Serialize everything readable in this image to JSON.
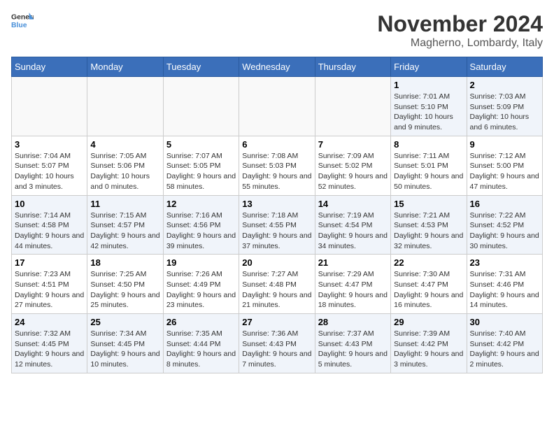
{
  "logo": {
    "text_general": "General",
    "text_blue": "Blue"
  },
  "title": "November 2024",
  "location": "Magherno, Lombardy, Italy",
  "days_of_week": [
    "Sunday",
    "Monday",
    "Tuesday",
    "Wednesday",
    "Thursday",
    "Friday",
    "Saturday"
  ],
  "weeks": [
    [
      {
        "day": "",
        "info": ""
      },
      {
        "day": "",
        "info": ""
      },
      {
        "day": "",
        "info": ""
      },
      {
        "day": "",
        "info": ""
      },
      {
        "day": "",
        "info": ""
      },
      {
        "day": "1",
        "info": "Sunrise: 7:01 AM\nSunset: 5:10 PM\nDaylight: 10 hours and 9 minutes."
      },
      {
        "day": "2",
        "info": "Sunrise: 7:03 AM\nSunset: 5:09 PM\nDaylight: 10 hours and 6 minutes."
      }
    ],
    [
      {
        "day": "3",
        "info": "Sunrise: 7:04 AM\nSunset: 5:07 PM\nDaylight: 10 hours and 3 minutes."
      },
      {
        "day": "4",
        "info": "Sunrise: 7:05 AM\nSunset: 5:06 PM\nDaylight: 10 hours and 0 minutes."
      },
      {
        "day": "5",
        "info": "Sunrise: 7:07 AM\nSunset: 5:05 PM\nDaylight: 9 hours and 58 minutes."
      },
      {
        "day": "6",
        "info": "Sunrise: 7:08 AM\nSunset: 5:03 PM\nDaylight: 9 hours and 55 minutes."
      },
      {
        "day": "7",
        "info": "Sunrise: 7:09 AM\nSunset: 5:02 PM\nDaylight: 9 hours and 52 minutes."
      },
      {
        "day": "8",
        "info": "Sunrise: 7:11 AM\nSunset: 5:01 PM\nDaylight: 9 hours and 50 minutes."
      },
      {
        "day": "9",
        "info": "Sunrise: 7:12 AM\nSunset: 5:00 PM\nDaylight: 9 hours and 47 minutes."
      }
    ],
    [
      {
        "day": "10",
        "info": "Sunrise: 7:14 AM\nSunset: 4:58 PM\nDaylight: 9 hours and 44 minutes."
      },
      {
        "day": "11",
        "info": "Sunrise: 7:15 AM\nSunset: 4:57 PM\nDaylight: 9 hours and 42 minutes."
      },
      {
        "day": "12",
        "info": "Sunrise: 7:16 AM\nSunset: 4:56 PM\nDaylight: 9 hours and 39 minutes."
      },
      {
        "day": "13",
        "info": "Sunrise: 7:18 AM\nSunset: 4:55 PM\nDaylight: 9 hours and 37 minutes."
      },
      {
        "day": "14",
        "info": "Sunrise: 7:19 AM\nSunset: 4:54 PM\nDaylight: 9 hours and 34 minutes."
      },
      {
        "day": "15",
        "info": "Sunrise: 7:21 AM\nSunset: 4:53 PM\nDaylight: 9 hours and 32 minutes."
      },
      {
        "day": "16",
        "info": "Sunrise: 7:22 AM\nSunset: 4:52 PM\nDaylight: 9 hours and 30 minutes."
      }
    ],
    [
      {
        "day": "17",
        "info": "Sunrise: 7:23 AM\nSunset: 4:51 PM\nDaylight: 9 hours and 27 minutes."
      },
      {
        "day": "18",
        "info": "Sunrise: 7:25 AM\nSunset: 4:50 PM\nDaylight: 9 hours and 25 minutes."
      },
      {
        "day": "19",
        "info": "Sunrise: 7:26 AM\nSunset: 4:49 PM\nDaylight: 9 hours and 23 minutes."
      },
      {
        "day": "20",
        "info": "Sunrise: 7:27 AM\nSunset: 4:48 PM\nDaylight: 9 hours and 21 minutes."
      },
      {
        "day": "21",
        "info": "Sunrise: 7:29 AM\nSunset: 4:47 PM\nDaylight: 9 hours and 18 minutes."
      },
      {
        "day": "22",
        "info": "Sunrise: 7:30 AM\nSunset: 4:47 PM\nDaylight: 9 hours and 16 minutes."
      },
      {
        "day": "23",
        "info": "Sunrise: 7:31 AM\nSunset: 4:46 PM\nDaylight: 9 hours and 14 minutes."
      }
    ],
    [
      {
        "day": "24",
        "info": "Sunrise: 7:32 AM\nSunset: 4:45 PM\nDaylight: 9 hours and 12 minutes."
      },
      {
        "day": "25",
        "info": "Sunrise: 7:34 AM\nSunset: 4:45 PM\nDaylight: 9 hours and 10 minutes."
      },
      {
        "day": "26",
        "info": "Sunrise: 7:35 AM\nSunset: 4:44 PM\nDaylight: 9 hours and 8 minutes."
      },
      {
        "day": "27",
        "info": "Sunrise: 7:36 AM\nSunset: 4:43 PM\nDaylight: 9 hours and 7 minutes."
      },
      {
        "day": "28",
        "info": "Sunrise: 7:37 AM\nSunset: 4:43 PM\nDaylight: 9 hours and 5 minutes."
      },
      {
        "day": "29",
        "info": "Sunrise: 7:39 AM\nSunset: 4:42 PM\nDaylight: 9 hours and 3 minutes."
      },
      {
        "day": "30",
        "info": "Sunrise: 7:40 AM\nSunset: 4:42 PM\nDaylight: 9 hours and 2 minutes."
      }
    ]
  ]
}
